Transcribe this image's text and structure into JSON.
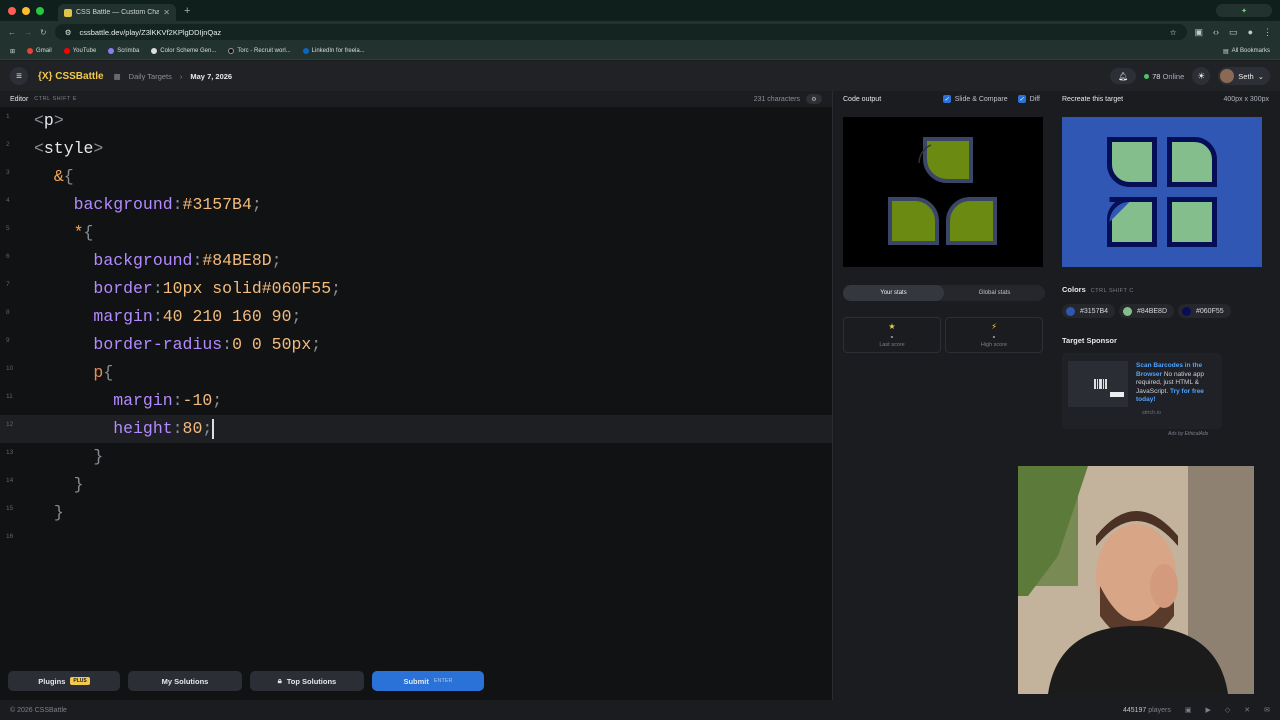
{
  "browser": {
    "tab_title": "CSS Battle — Custom Challe",
    "url": "cssbattle.dev/play/Z3lKKVf2KPlgDDIjnQaz",
    "bookmarks": [
      "Gmail",
      "YouTube",
      "Scrimba",
      "Color Scheme Gen...",
      "Torc - Recruit worl...",
      "LinkedIn for freela..."
    ],
    "all_bookmarks": "All Bookmarks"
  },
  "app": {
    "logo": "{X} CSSBattle",
    "crumb_section": "Daily Targets",
    "crumb_date": "May 7, 2026",
    "online_count": "78",
    "online_label": "Online",
    "user_name": "Seth"
  },
  "editor": {
    "title": "Editor",
    "shortcut": "CTRL SHIFT E",
    "char_count": "231 characters",
    "lines": [
      {
        "n": "1",
        "parts": [
          [
            "br",
            "<"
          ],
          [
            "tag",
            "p"
          ],
          [
            "br",
            ">"
          ]
        ]
      },
      {
        "n": "2",
        "parts": [
          [
            "br",
            "<"
          ],
          [
            "tag",
            "style"
          ],
          [
            "br",
            ">"
          ]
        ]
      },
      {
        "n": "3",
        "parts": [
          [
            "sp",
            "  "
          ],
          [
            "amp",
            "&"
          ],
          [
            "br",
            "{"
          ]
        ]
      },
      {
        "n": "4",
        "parts": [
          [
            "sp",
            "    "
          ],
          [
            "prop",
            "background"
          ],
          [
            "br",
            ":"
          ],
          [
            "val",
            "#3157B4"
          ],
          [
            "br",
            ";"
          ]
        ]
      },
      {
        "n": "5",
        "parts": [
          [
            "sp",
            "    "
          ],
          [
            "amp",
            "*"
          ],
          [
            "br",
            "{"
          ]
        ]
      },
      {
        "n": "6",
        "parts": [
          [
            "sp",
            "      "
          ],
          [
            "prop",
            "background"
          ],
          [
            "br",
            ":"
          ],
          [
            "val",
            "#84BE8D"
          ],
          [
            "br",
            ";"
          ]
        ]
      },
      {
        "n": "7",
        "parts": [
          [
            "sp",
            "      "
          ],
          [
            "prop",
            "border"
          ],
          [
            "br",
            ":"
          ],
          [
            "val",
            "10px solid"
          ],
          [
            "val",
            "#060F55"
          ],
          [
            "br",
            ";"
          ]
        ]
      },
      {
        "n": "8",
        "parts": [
          [
            "sp",
            "      "
          ],
          [
            "prop",
            "margin"
          ],
          [
            "br",
            ":"
          ],
          [
            "val",
            "40 210 160 90"
          ],
          [
            "br",
            ";"
          ]
        ]
      },
      {
        "n": "9",
        "parts": [
          [
            "sp",
            "      "
          ],
          [
            "prop",
            "border-radius"
          ],
          [
            "br",
            ":"
          ],
          [
            "val",
            "0 0 50px"
          ],
          [
            "br",
            ";"
          ]
        ]
      },
      {
        "n": "10",
        "parts": [
          [
            "sp",
            "      "
          ],
          [
            "sel",
            "p"
          ],
          [
            "br",
            "{"
          ]
        ]
      },
      {
        "n": "11",
        "parts": [
          [
            "sp",
            "        "
          ],
          [
            "prop",
            "margin"
          ],
          [
            "br",
            ":"
          ],
          [
            "val",
            "-10"
          ],
          [
            "br",
            ";"
          ]
        ]
      },
      {
        "n": "12",
        "parts": [
          [
            "sp",
            "        "
          ],
          [
            "prop",
            "height"
          ],
          [
            "br",
            ":"
          ],
          [
            "val",
            "80"
          ],
          [
            "br",
            ";"
          ]
        ]
      },
      {
        "n": "13",
        "parts": [
          [
            "sp",
            "      "
          ],
          [
            "br",
            "}"
          ]
        ]
      },
      {
        "n": "14",
        "parts": [
          [
            "sp",
            "    "
          ],
          [
            "br",
            "}"
          ]
        ]
      },
      {
        "n": "15",
        "parts": [
          [
            "sp",
            "  "
          ],
          [
            "br",
            "}"
          ]
        ]
      },
      {
        "n": "16",
        "parts": []
      }
    ]
  },
  "bottom_bar": {
    "plugins": "Plugins",
    "plus_badge": "PLUS",
    "my_solutions": "My Solutions",
    "top_solutions": "Top Solutions",
    "submit": "Submit",
    "submit_key": "ENTER"
  },
  "output": {
    "title": "Code output",
    "slide_compare": "Slide & Compare",
    "diff": "Diff",
    "your_stats": "Your stats",
    "global_stats": "Global stats",
    "last_score_value": "-",
    "last_score_label": "Last score",
    "high_score_value": "-",
    "high_score_label": "High score"
  },
  "target": {
    "title": "Recreate this target",
    "dimensions": "400px x 300px",
    "colors_heading": "Colors",
    "colors_shortcut": "CTRL SHIFT C",
    "colors": [
      "#3157B4",
      "#84BE8D",
      "#060F55"
    ],
    "sponsor_heading": "Target Sponsor",
    "sponsor_title": "Scan Barcodes in the Browser",
    "sponsor_body": "No native app required, just HTML & JavaScript.",
    "sponsor_cta": "Try for free today!",
    "sponsor_domain": "strich.io",
    "ads_by": "Ads by EthicalAds"
  },
  "footer": {
    "copyright": "© 2026 CSSBattle",
    "players_count": "445197",
    "players_label": "players"
  }
}
